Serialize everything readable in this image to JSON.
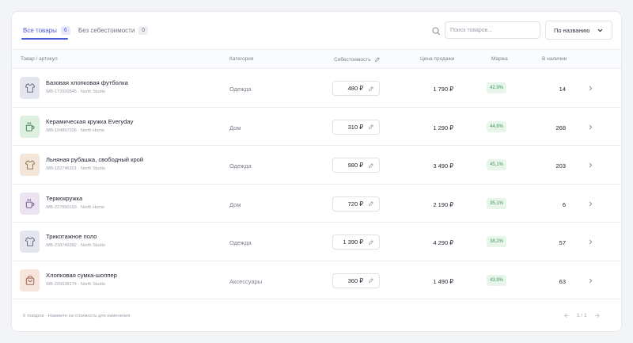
{
  "tabs": [
    {
      "label": "Все товары",
      "count": "6",
      "active": true
    },
    {
      "label": "Без себестоимости",
      "count": "0",
      "active": false
    }
  ],
  "search": {
    "placeholder": "Поиск товаров..."
  },
  "sort": {
    "selected": "По названию"
  },
  "columns": {
    "product": "Товар / артикул",
    "category": "Категория",
    "cost": "Себестоимость",
    "price": "Цена продажи",
    "margin": "Маржа",
    "stock": "В наличии"
  },
  "products": [
    {
      "name": "Базовая хлопковая футболка",
      "sku": "WB-173920845 · North Studio",
      "category": "Одежда",
      "cost": "480 ₽",
      "price": "1 790 ₽",
      "margin": "42,9%",
      "stock": "14",
      "icon": "tshirt-icon",
      "thumb_bg": "#e3e6ee",
      "icon_color": "#6a7287"
    },
    {
      "name": "Керамическая кружка Everyday",
      "sku": "WB-194857206 · North Home",
      "category": "Дом",
      "cost": "310 ₽",
      "price": "1 290 ₽",
      "margin": "44,6%",
      "stock": "268",
      "icon": "mug-icon",
      "thumb_bg": "#dcefe0",
      "icon_color": "#4e8a5e"
    },
    {
      "name": "Льняная рубашка, свободный крой",
      "sku": "WB-182746301 · North Studio",
      "category": "Одежда",
      "cost": "980 ₽",
      "price": "3 490 ₽",
      "margin": "45,1%",
      "stock": "203",
      "icon": "tshirt-icon",
      "thumb_bg": "#f3e6d8",
      "icon_color": "#9a7a56"
    },
    {
      "name": "Термокружка",
      "sku": "WB-227850193 · North Home",
      "category": "Дом",
      "cost": "720 ₽",
      "price": "2 190 ₽",
      "margin": "35,1%",
      "stock": "6",
      "icon": "mug-icon",
      "thumb_bg": "#ebe3f1",
      "icon_color": "#7d6896"
    },
    {
      "name": "Трикотажное поло",
      "sku": "WB-218749382 · North Studio",
      "category": "Одежда",
      "cost": "1 390 ₽",
      "price": "4 290 ₽",
      "margin": "38,2%",
      "stock": "57",
      "icon": "tshirt-icon",
      "thumb_bg": "#e3e6ee",
      "icon_color": "#6a7287"
    },
    {
      "name": "Хлопковая сумка-шоппер",
      "sku": "WB-205638174 · North Studio",
      "category": "Аксессуары",
      "cost": "360 ₽",
      "price": "1 490 ₽",
      "margin": "43,9%",
      "stock": "63",
      "icon": "bag-icon",
      "thumb_bg": "#f6e4dd",
      "icon_color": "#a16a57"
    }
  ],
  "footer": {
    "note": "6 товаров · Нажмите на стоимость для изменения",
    "page": "1 / 1"
  },
  "colors": {
    "accent": "#4b5bd6",
    "margin_text": "#3f9b5c",
    "margin_bg": "#e7f5eb"
  }
}
